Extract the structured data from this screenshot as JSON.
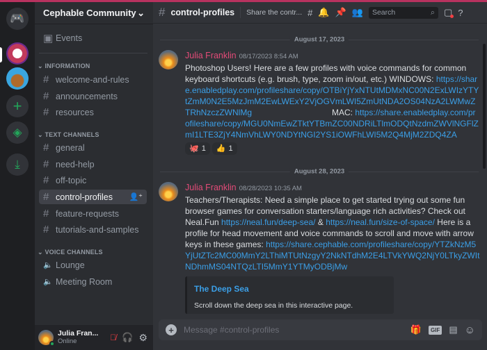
{
  "colors": {
    "accent": "#b8325f",
    "link": "#3b9fe7",
    "username": "#e34b78",
    "online": "#23a55a"
  },
  "rail": {
    "icons": [
      "discord-home-icon",
      "cephable-server-icon",
      "community-server-icon",
      "add-server-icon",
      "explore-icon",
      "download-icon"
    ]
  },
  "server": {
    "name": "Cephable Community",
    "events": "Events",
    "categories": [
      {
        "label": "INFORMATION",
        "channels": [
          "welcome-and-rules",
          "announcements",
          "resources"
        ]
      },
      {
        "label": "TEXT CHANNELS",
        "channels": [
          "general",
          "need-help",
          "off-topic",
          "control-profiles",
          "feature-requests",
          "tutorials-and-samples"
        ]
      },
      {
        "label": "VOICE CHANNELS",
        "channels": [
          "Lounge",
          "Meeting Room"
        ]
      }
    ]
  },
  "user": {
    "name": "Julia Fran...",
    "status": "Online"
  },
  "header": {
    "channel": "control-profiles",
    "topic": "Share the contr...",
    "search_placeholder": "Search"
  },
  "messages": [
    {
      "date": "August 17, 2023",
      "author": "Julia Franklin",
      "time": "08/17/2023 8:54 AM",
      "text1": "Photoshop Users! Here are a few profiles with voice commands for common keyboard shortcuts (e.g. brush, type, zoom in/out, etc.)  WINDOWS:",
      "link1": "https://share.enabledplay.com/profileshare/copy/OTBiYjYxNTUtMDMxNC00N2ExLWIzYTYtZmM0N2E5MzJmM2EwLWExY2VjOGVmLWI5ZmUtNDA2OS04NzA2LWMwZTRhNzczZWNlMg",
      "text2": "MAC:",
      "link2": "https://share.enabledplay.com/profileshare/copy/MGU0NmEwZTktYTBmZC00NDRiLTlmODQtNzdmZWVlNGFlZmI1LTE3ZjY4NmVhLWY0NDYtNGI2YS1iOWFhLWI5M2Q4MjM2ZDQ4ZA",
      "reactions": [
        {
          "emoji": "🐙",
          "count": "1"
        },
        {
          "emoji": "👍",
          "count": "1"
        }
      ]
    },
    {
      "date": "August 28, 2023",
      "author": "Julia Franklin",
      "time": "08/28/2023 10:35 AM",
      "text1": "Teachers/Therapists: Need a simple place to get started trying out some fun browser games for conversation starters/language rich activities? Check out Neal.Fun",
      "link1": "https://neal.fun/deep-sea/",
      "amp": "&",
      "link2": "https://neal.fun/size-of-space/",
      "text2": "Here is a profile for head movement and voice commands to scroll and move with arrow keys in these games:",
      "link3": "https://share.cephable.com/profileshare/copy/YTZkNzM5YjUtZTc2MC00MmY2LThiMTUtNzgyY2NkNTdhM2E4LTVkYWQ2NjY0LTkyZWItNDhmMS04NTQzLTI5MmY1YTMyODBjMw",
      "embed": {
        "title": "The Deep Sea",
        "description": "Scroll down the deep sea in this interactive page."
      }
    }
  ],
  "composer": {
    "placeholder": "Message #control-profiles"
  }
}
